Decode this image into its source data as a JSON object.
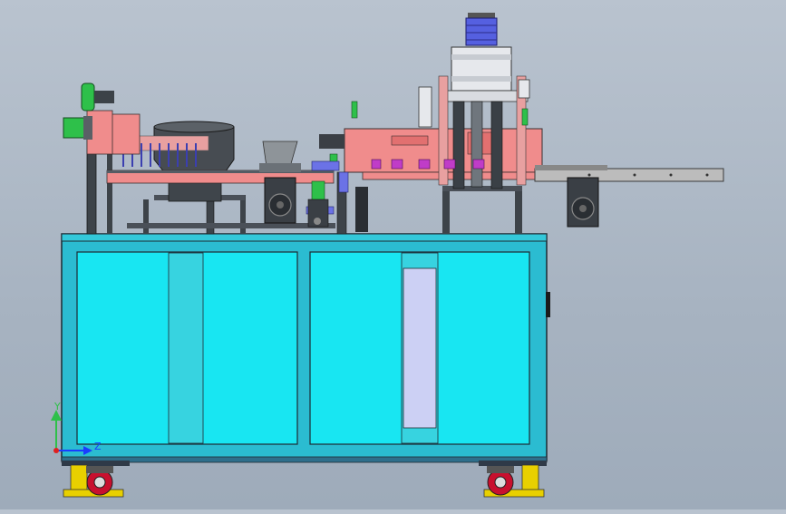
{
  "viewport": {
    "background": "#a9b5c3"
  },
  "colors": {
    "cabinet_frame": "#2bbcd1",
    "cabinet_panel": "#18e6f2",
    "cabinet_divider": "#37d3e0",
    "machine_plate": "#f08c8c",
    "frame_dark": "#2e3236",
    "cylinder_blue": "#5560e0",
    "accent_green": "#2ec04a",
    "accent_magenta": "#c03cc8",
    "wheel_red": "#c8102e",
    "caster_yellow": "#e8d000",
    "window_lavender": "#ccd0f4"
  },
  "triad": {
    "x_label": "",
    "y_label": "Y",
    "z_label": "Z",
    "y_color": "#2ec04a",
    "z_color": "#1a3cff",
    "x_color": "#e02020"
  }
}
